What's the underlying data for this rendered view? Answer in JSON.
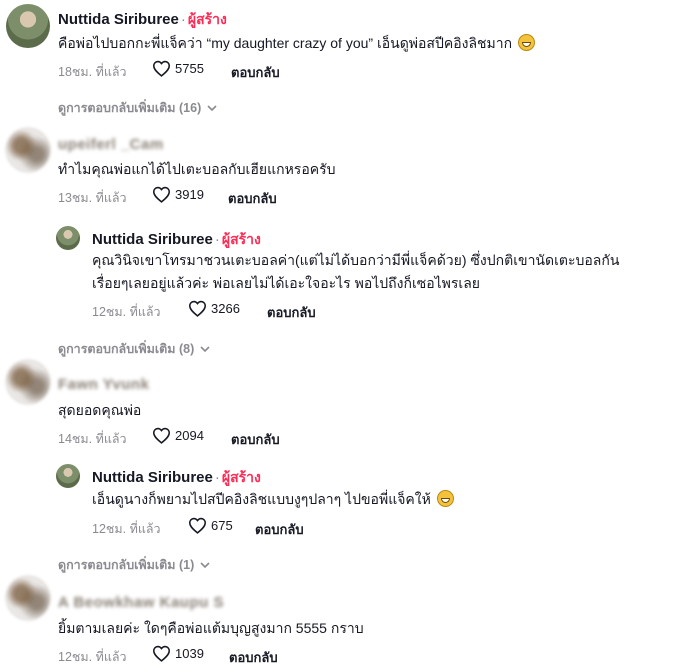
{
  "comments": [
    {
      "author": "Nuttida Siriburee",
      "creator_badge": "ผู้สร้าง",
      "text": "คือพ่อไปบอกกะพี่แจ็คว่า “my daughter crazy of you” เอ็นดูพ่อสปีคอิงลิชมาก",
      "emoji": "grinning-face",
      "time": "18ชม. ที่แล้ว",
      "likes": "5755",
      "reply_label": "ตอบกลับ",
      "more_replies": "ดูการตอบกลับเพิ่มเติม (16)"
    },
    {
      "author": "upeiferl _Cam",
      "text": "ทำไมคุณพ่อแกได้ไปเตะบอลกับเฮียแกหรอครับ",
      "time": "13ชม. ที่แล้ว",
      "likes": "3919",
      "reply_label": "ตอบกลับ",
      "reply": {
        "author": "Nuttida Siriburee",
        "creator_badge": "ผู้สร้าง",
        "text_line1": "คุณวินิจเขาโทรมาชวนเตะบอลค่า(แต่ไม่ได้บอกว่ามีพี่แจ็คด้วย) ซึ่งปกติเขานัดเตะบอลกัน",
        "text_line2": "เรื่อยๆเลยอยู่แล้วค่ะ พ่อเลยไม่ได้เอะใจอะไร พอไปถึงก็เซอไพรเลย",
        "time": "12ชม. ที่แล้ว",
        "likes": "3266",
        "reply_label": "ตอบกลับ"
      },
      "more_replies": "ดูการตอบกลับเพิ่มเติม (8)"
    },
    {
      "author": "Fawn Yvunk",
      "text": "สุดยอดคุณพ่อ",
      "time": "14ชม. ที่แล้ว",
      "likes": "2094",
      "reply_label": "ตอบกลับ",
      "reply": {
        "author": "Nuttida Siriburee",
        "creator_badge": "ผู้สร้าง",
        "text": "เอ็นดูนางก็พยามไปสปีคอิงลิชแบบงูๆปลาๆ ไปขอพี่แจ็คให้",
        "emoji": "grinning-face",
        "time": "12ชม. ที่แล้ว",
        "likes": "675",
        "reply_label": "ตอบกลับ"
      },
      "more_replies": "ดูการตอบกลับเพิ่มเติม (1)"
    },
    {
      "author": "A Beowkhaw Kaupu S",
      "text": "ยิ้มตามเลยค่ะ ใดๆคือพ่อแต้มบุญสูงมาก 5555 กราบ",
      "time": "12ชม. ที่แล้ว",
      "likes": "1039",
      "reply_label": "ตอบกลับ"
    }
  ],
  "icons": {
    "like": "heart-outline-icon",
    "expand": "chevron-down-icon"
  },
  "colors": {
    "creator": "#fe2c55",
    "muted": "#8a8b91",
    "text": "#161823"
  }
}
